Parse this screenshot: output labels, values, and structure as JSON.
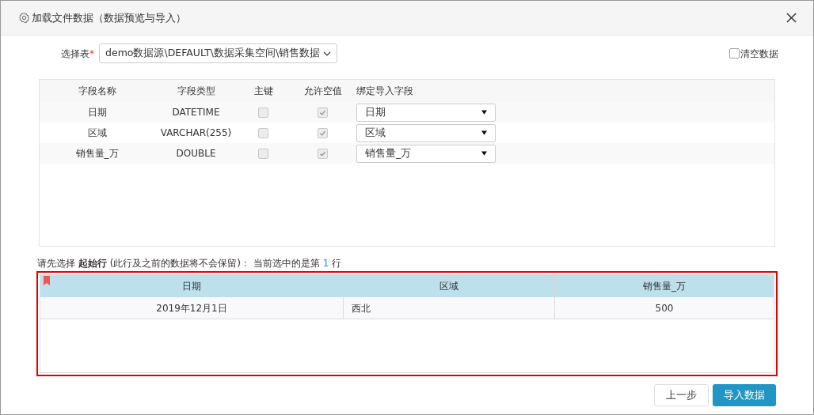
{
  "dialog": {
    "title": "加载文件数据（数据预览与导入）"
  },
  "table_select": {
    "label": "选择表",
    "required_mark": "*",
    "value": "demo数据源\\DEFAULT\\数据采集空间\\销售数据"
  },
  "clear_data": {
    "label": "清空数据",
    "checked": false
  },
  "fields": {
    "columns": [
      "字段名称",
      "字段类型",
      "主键",
      "允许空值",
      "绑定导入字段"
    ],
    "rows": [
      {
        "name": "日期",
        "type": "DATETIME",
        "primary_key": {
          "checked": false,
          "disabled": true
        },
        "nullable": {
          "checked": true,
          "disabled": true
        },
        "binding": "日期"
      },
      {
        "name": "区域",
        "type": "VARCHAR(255)",
        "primary_key": {
          "checked": false,
          "disabled": true
        },
        "nullable": {
          "checked": true,
          "disabled": true
        },
        "binding": "区域"
      },
      {
        "name": "销售量_万",
        "type": "DOUBLE",
        "primary_key": {
          "checked": false,
          "disabled": true
        },
        "nullable": {
          "checked": true,
          "disabled": true
        },
        "binding": "销售量_万"
      }
    ]
  },
  "hint": {
    "text": "请先选择 **起始行** (此行及之前的数据将不会保留)： 当前选中的是第",
    "row_number": "1",
    "suffix": "行"
  },
  "preview": {
    "columns": [
      "日期",
      "区域",
      "销售量_万"
    ],
    "rows": [
      {
        "cells": [
          "2019年12月1日",
          "西北",
          "500"
        ]
      }
    ]
  },
  "buttons": [
    {
      "label": "上一步",
      "kind": "secondary"
    },
    {
      "label": "导入数据",
      "kind": "primary"
    }
  ]
}
